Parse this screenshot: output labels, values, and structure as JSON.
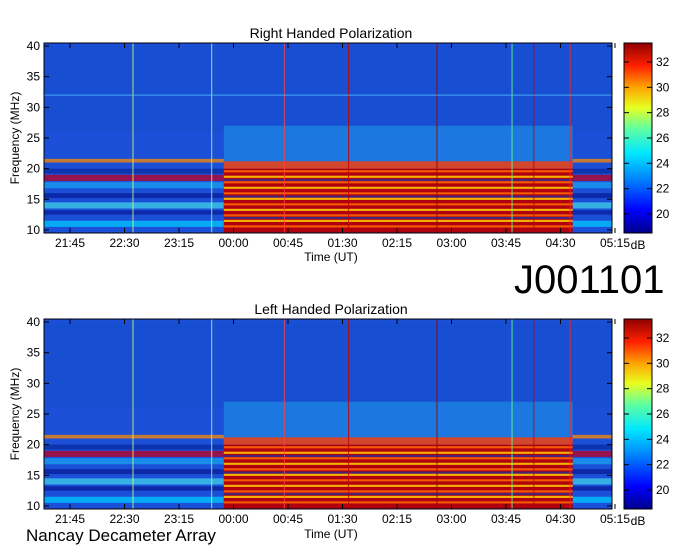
{
  "observation_id": "J001101",
  "credit": "Nancay Decameter Array",
  "chart_data": [
    {
      "type": "heatmap",
      "title": "Right Handed Polarization",
      "xlabel": "Time (UT)",
      "ylabel": "Frequency (MHz)",
      "x_ticks": [
        "21:45",
        "22:30",
        "23:15",
        "00:00",
        "00:45",
        "01:30",
        "02:15",
        "03:00",
        "03:45",
        "04:30",
        "05:15"
      ],
      "y_ticks": [
        10,
        15,
        20,
        25,
        30,
        35,
        40
      ],
      "ylim": [
        9.5,
        40.5
      ],
      "colorbar": {
        "label": "dB",
        "ticks": [
          20,
          22,
          24,
          26,
          28,
          30,
          32
        ],
        "range": [
          18.5,
          33.5
        ]
      },
      "bright_interval": [
        "23:52",
        "04:40"
      ],
      "strong_emission_band_mhz": [
        10,
        20
      ]
    },
    {
      "type": "heatmap",
      "title": "Left Handed Polarization",
      "xlabel": "Time (UT)",
      "ylabel": "Frequency (MHz)",
      "x_ticks": [
        "21:45",
        "22:30",
        "23:15",
        "00:00",
        "00:45",
        "01:30",
        "02:15",
        "03:00",
        "03:45",
        "04:30",
        "05:15"
      ],
      "y_ticks": [
        10,
        15,
        20,
        25,
        30,
        35,
        40
      ],
      "ylim": [
        9.5,
        40.5
      ],
      "colorbar": {
        "label": "dB",
        "ticks": [
          20,
          22,
          24,
          26,
          28,
          30,
          32
        ],
        "range": [
          18.5,
          33.5
        ]
      },
      "bright_interval": [
        "23:52",
        "04:40"
      ],
      "strong_emission_band_mhz": [
        10,
        20
      ]
    }
  ]
}
